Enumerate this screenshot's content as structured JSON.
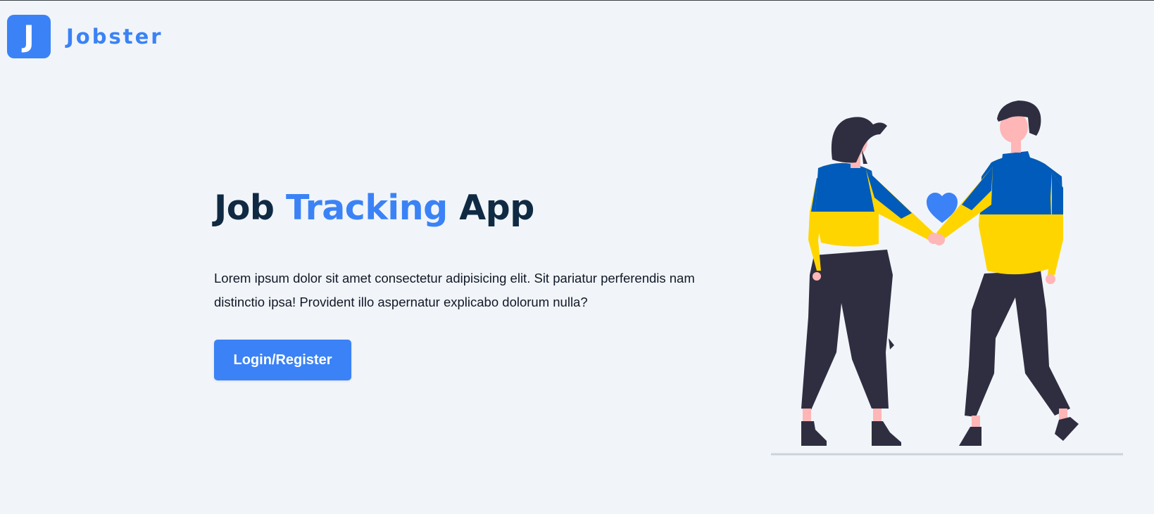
{
  "navbar": {
    "logo_letter": "J",
    "logo_text": "Jobster"
  },
  "hero": {
    "title_part1": "Job ",
    "title_accent": "Tracking",
    "title_part2": " App",
    "description": "Lorem ipsum dolor sit amet consectetur adipisicing elit. Sit pariatur perferendis nam distinctio ipsa! Provident illo aspernatur explicabo dolorum nulla?",
    "button_label": "Login/Register"
  },
  "colors": {
    "accent": "#3b82f6",
    "background": "#f1f5f9",
    "heading": "#102a43",
    "sweater_blue": "#005bbb",
    "sweater_yellow": "#ffd500",
    "pants": "#2f2e41",
    "skin": "#ffb6b6"
  },
  "icons": {
    "logo": "logo-icon",
    "heart": "heart-icon"
  }
}
